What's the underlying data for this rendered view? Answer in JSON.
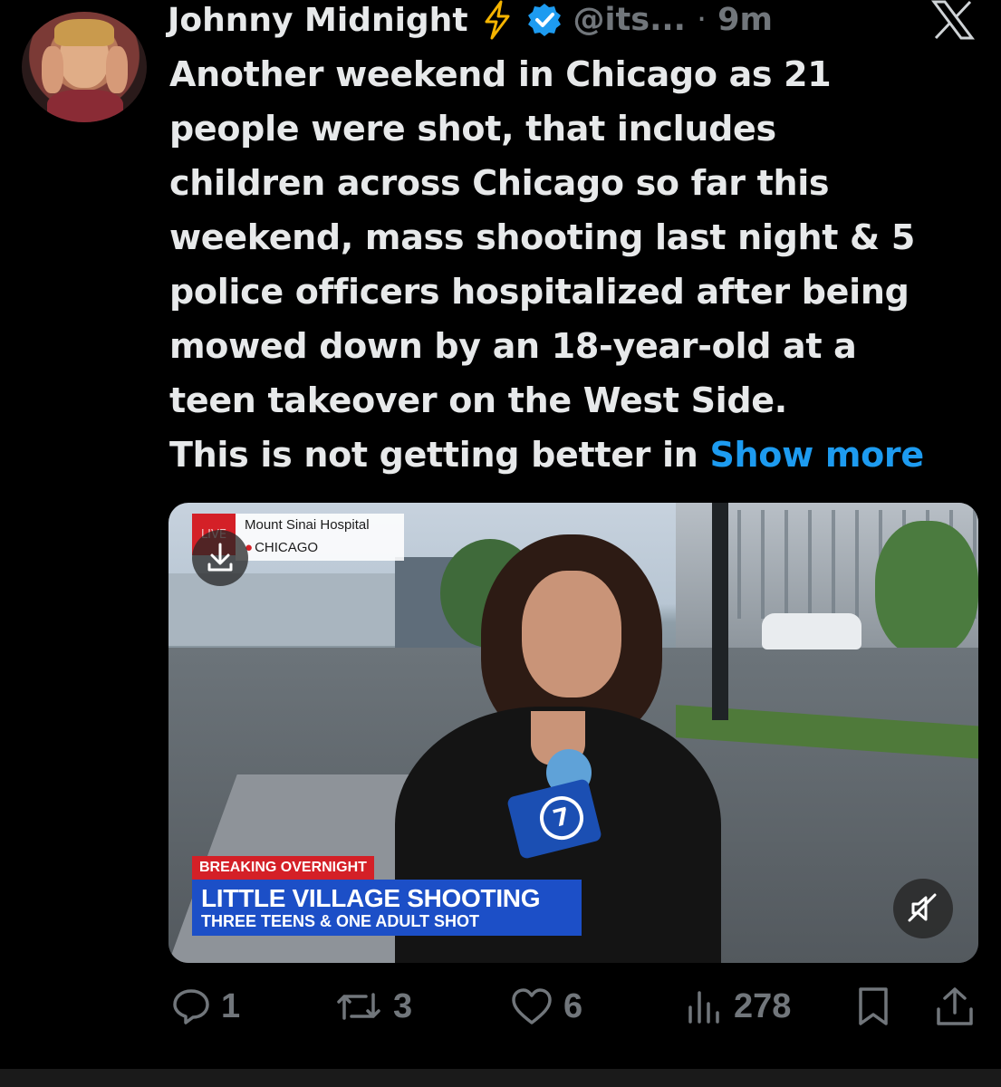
{
  "tweet": {
    "author_name": "Johnny Midnight",
    "handle": "@its...",
    "separator": "·",
    "time": "9m",
    "text_lines": [
      "Another weekend in Chicago as 21",
      "people were shot, that includes",
      "children across Chicago so far this",
      "weekend, mass shooting last night & 5",
      "police officers hospitalized after being",
      "mowed down by an 18-year-old at a",
      "teen takeover on the West Side.",
      "This is not getting better in"
    ],
    "show_more": "Show more"
  },
  "media": {
    "live_label": "LIVE",
    "location_title": "Mount Sinai Hospital",
    "location_city": "CHICAGO",
    "mic_logo": "7",
    "banner_top": "BREAKING OVERNIGHT",
    "banner_main": "LITTLE VILLAGE SHOOTING",
    "banner_sub": "THREE TEENS & ONE ADULT SHOT"
  },
  "actions": {
    "replies": "1",
    "reposts": "3",
    "likes": "6",
    "views": "278"
  },
  "colors": {
    "background": "#000000",
    "text": "#e7e9ea",
    "muted": "#71767b",
    "link": "#1d9bf0",
    "verified": "#1d9bf0",
    "bolt": "#f5b400",
    "breaking": "#d42027",
    "banner": "#1c4fc7"
  },
  "icons": [
    "lightning-bolt-icon",
    "verified-badge-icon",
    "x-logo-icon",
    "download-icon",
    "mute-icon",
    "reply-icon",
    "repost-icon",
    "like-icon",
    "views-icon",
    "bookmark-icon",
    "share-icon"
  ]
}
